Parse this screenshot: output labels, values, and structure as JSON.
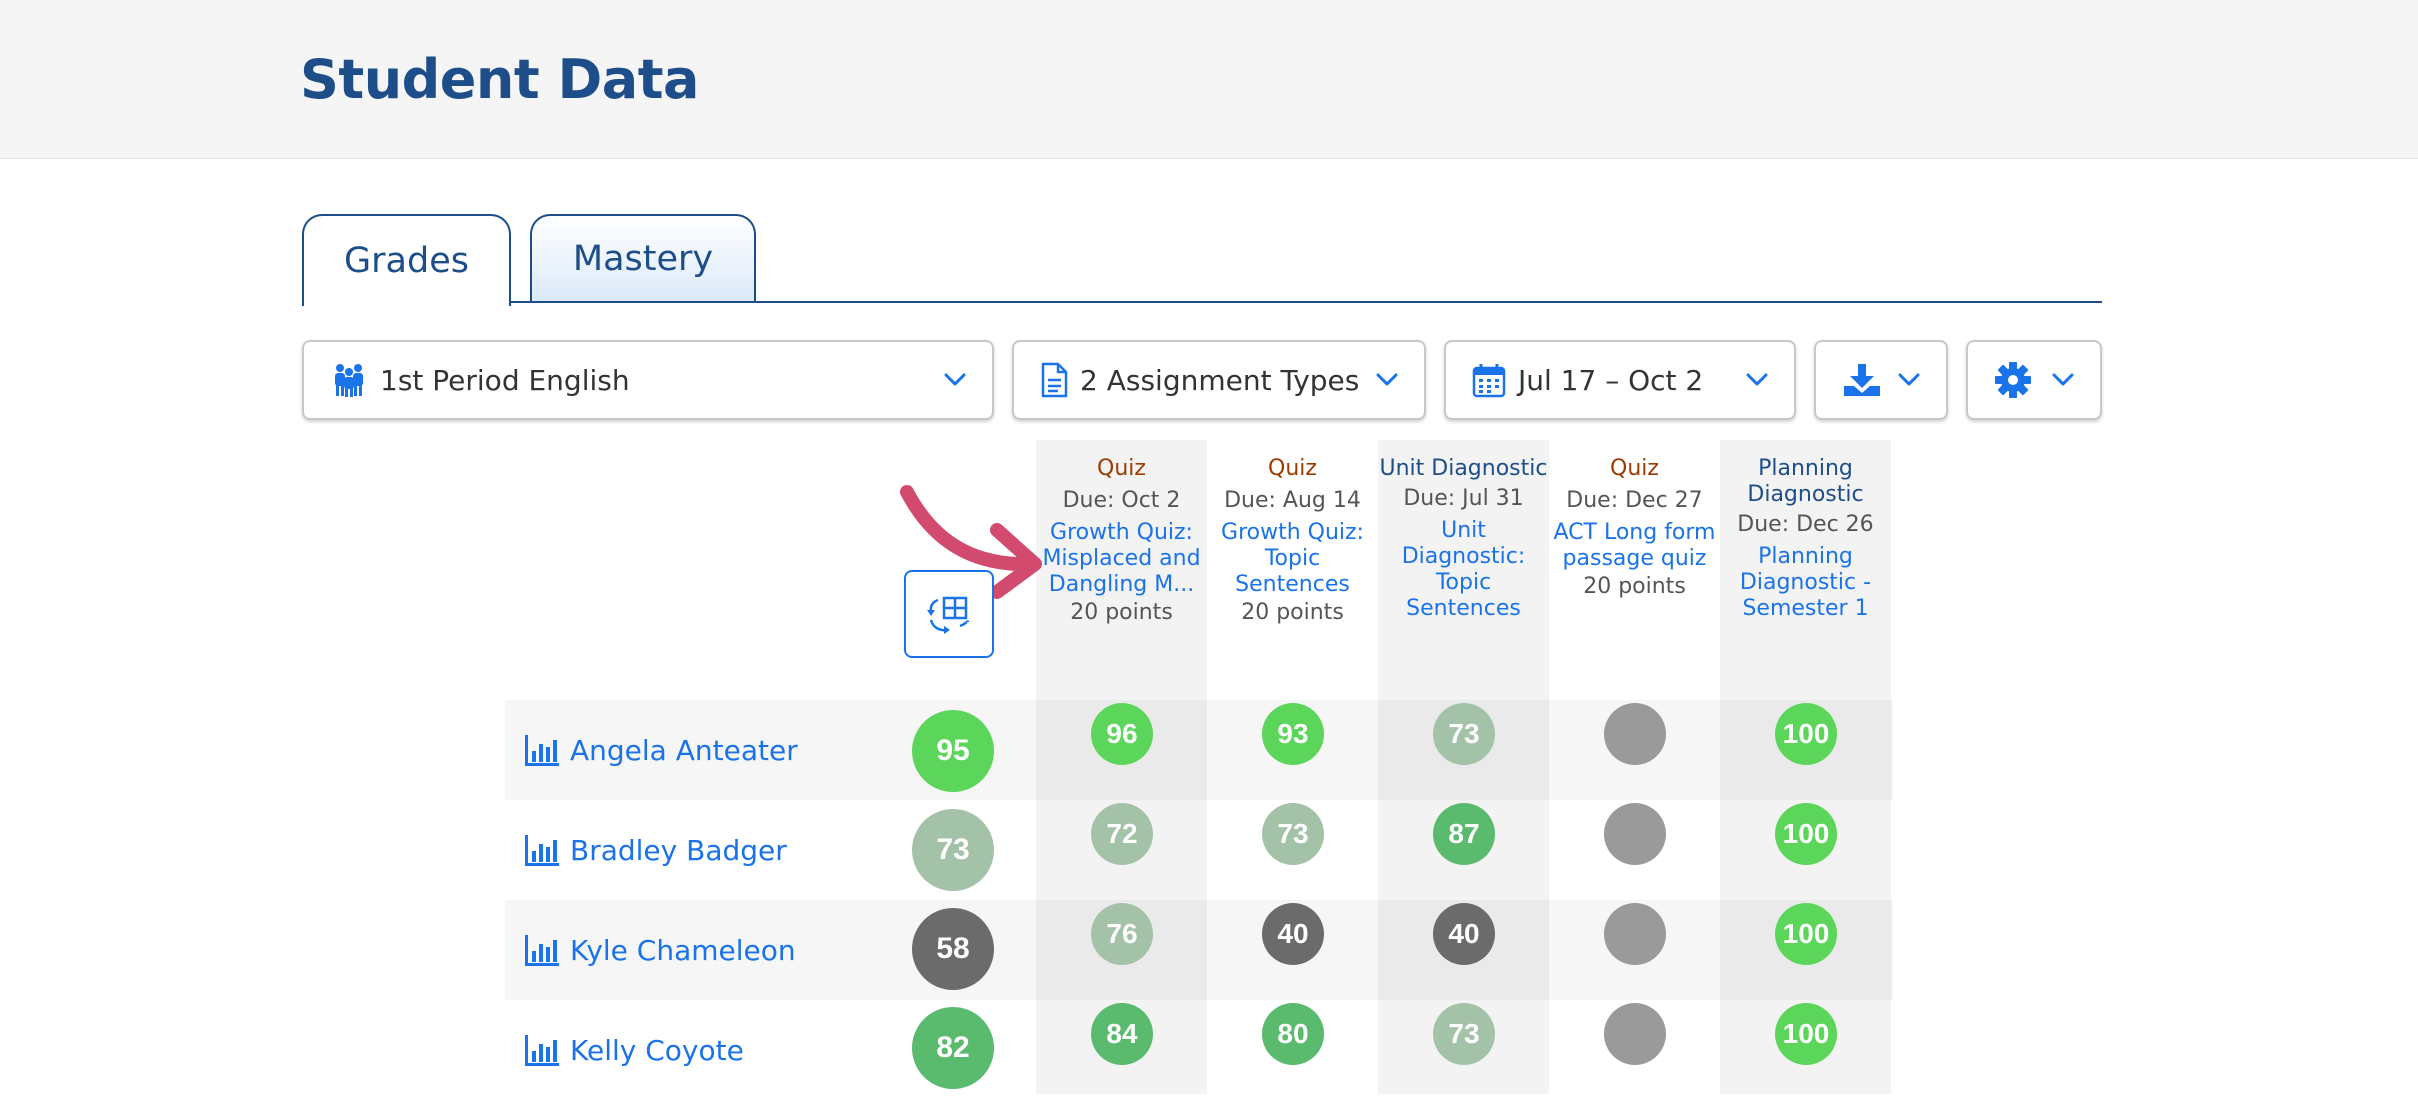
{
  "header": {
    "title": "Student Data"
  },
  "tabs": [
    {
      "label": "Grades"
    },
    {
      "label": "Mastery"
    }
  ],
  "filters": {
    "class_label": "1st Period English",
    "assignment_types_label": "2 Assignment Types",
    "date_range_label": "Jul 17 – Oct 2",
    "download_icon": "download-icon",
    "settings_icon": "gear-icon"
  },
  "assignments": [
    {
      "type": "Quiz",
      "due": "Due: Oct 2",
      "name": "Growth Quiz: Misplaced and Dangling M...",
      "points": "20 points"
    },
    {
      "type": "Quiz",
      "due": "Due: Aug 14",
      "name": "Growth Quiz: Topic Sentences",
      "points": "20 points"
    },
    {
      "type": "Unit Diagnostic",
      "due": "Due: Jul 31",
      "name": "Unit Diagnostic: Topic Sentences",
      "points": ""
    },
    {
      "type": "Quiz",
      "due": "Due: Dec 27",
      "name": "ACT Long form passage quiz",
      "points": "20 points"
    },
    {
      "type": "Planning Diagnostic",
      "due": "Due: Dec 26",
      "name": "Planning Diagnostic - Semester 1",
      "points": ""
    }
  ],
  "students": [
    {
      "name": "Angela Anteater",
      "overall": "95",
      "scores": [
        "96",
        "93",
        "73",
        "",
        "100"
      ]
    },
    {
      "name": "Bradley Badger",
      "overall": "73",
      "scores": [
        "72",
        "73",
        "87",
        "",
        "100"
      ]
    },
    {
      "name": "Kyle Chameleon",
      "overall": "58",
      "scores": [
        "76",
        "40",
        "40",
        "",
        "100"
      ]
    },
    {
      "name": "Kelly Coyote",
      "overall": "82",
      "scores": [
        "84",
        "80",
        "73",
        "",
        "100"
      ]
    }
  ],
  "colors": {
    "title": "#1d4e89",
    "link": "#1a73e8",
    "quiz_type": "#9b3d00",
    "score_high": "#5bd65b",
    "score_good": "#5aba6e",
    "score_mid": "#a3c2a8",
    "score_low": "#6b6b6b",
    "score_empty": "#9a9a9a"
  }
}
